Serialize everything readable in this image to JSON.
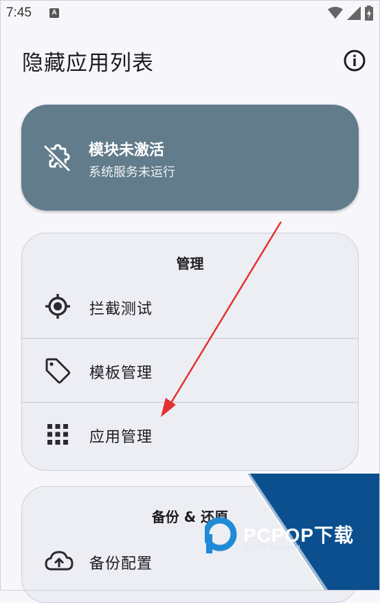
{
  "status_bar": {
    "time": "7:45",
    "notification_icon_letter": "A",
    "icons": [
      "wifi-icon",
      "signal-icon",
      "battery-charging-icon"
    ]
  },
  "app_bar": {
    "title": "隐藏应用列表",
    "action_icon": "info-icon"
  },
  "status_card": {
    "icon": "extension-off-icon",
    "title": "模块未激活",
    "subtitle": "系统服务未运行",
    "color": "#627c8b"
  },
  "sections": {
    "manage": {
      "title": "管理",
      "items": [
        {
          "label": "拦截测试",
          "icon": "gps-target-icon"
        },
        {
          "label": "模板管理",
          "icon": "tag-icon"
        },
        {
          "label": "应用管理",
          "icon": "apps-grid-icon"
        }
      ]
    },
    "backup": {
      "title": "备份 & 还原",
      "items": [
        {
          "label": "备份配置",
          "icon": "cloud-upload-icon"
        }
      ]
    }
  },
  "watermark": {
    "brand": "PCPOP下载",
    "sub": "PCPOP Download",
    "colors": {
      "blue": "#0b4f8f",
      "accent": "#1f8bd6"
    }
  },
  "annotation": {
    "arrow_color": "#e53030"
  }
}
